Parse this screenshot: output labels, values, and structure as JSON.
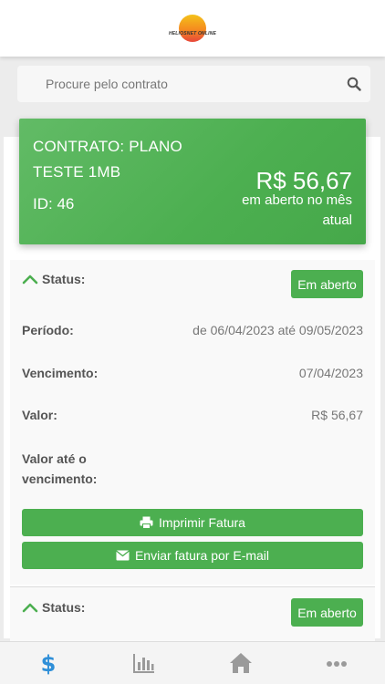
{
  "header": {
    "logo_text": "HELIOSNET ONLINE"
  },
  "search": {
    "placeholder": "Procure pelo contrato"
  },
  "contract": {
    "title": "CONTRATO: PLANO TESTE 1MB",
    "id": "ID: 46",
    "amount": "R$ 56,67",
    "amount_note": "em aberto no mês atual"
  },
  "invoices": [
    {
      "status_label": "Status:",
      "status": "Em aberto",
      "period_label": "Período:",
      "period": "de 06/04/2023 até 09/05/2023",
      "due_label": "Vencimento:",
      "due": "07/04/2023",
      "value_label": "Valor:",
      "value": "R$ 56,67",
      "value_until_due_label": "Valor até o vencimento:",
      "value_until_due": "",
      "print_button": "Imprimir Fatura",
      "email_button": "Enviar fatura por E-mail"
    },
    {
      "status_label": "Status:",
      "status": "Em aberto"
    }
  ],
  "nav": {
    "items": [
      {
        "icon": "dollar-icon",
        "active": true
      },
      {
        "icon": "bar-chart-icon",
        "active": false
      },
      {
        "icon": "home-icon",
        "active": false
      },
      {
        "icon": "more-icon",
        "active": false
      }
    ]
  },
  "colors": {
    "accent": "#4caf50",
    "active_nav": "#2f8fd8",
    "inactive_nav": "#9a9a9a"
  }
}
